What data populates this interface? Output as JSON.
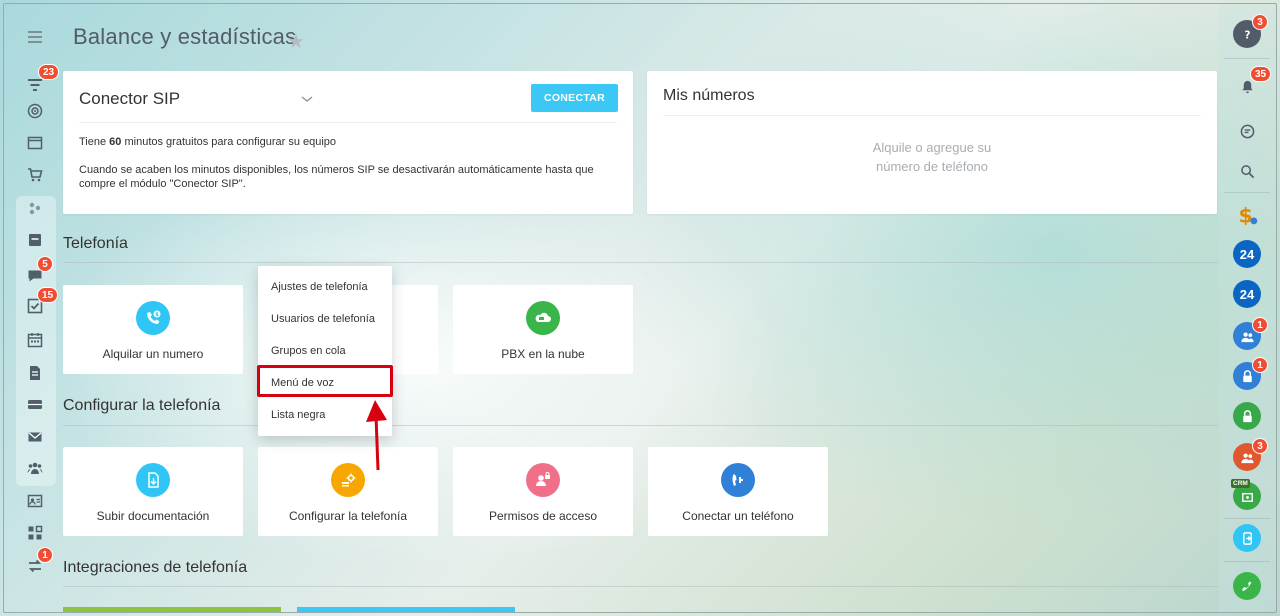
{
  "header": {
    "title": "Balance y estadísticas"
  },
  "sidebar": {
    "badges": {
      "filter": "23",
      "chat": "5",
      "tasks": "15",
      "sync": "1"
    }
  },
  "sip_card": {
    "title": "Conector SIP",
    "connect_label": "CONECTAR",
    "line1_pre": "Tiene ",
    "line1_bold": "60",
    "line1_post": " minutos gratuitos para configurar su equipo",
    "line2": "Cuando se acaben los minutos disponibles, los números SIP se desactivarán automáticamente hasta que compre el módulo \"Conector SIP\"."
  },
  "numbers_card": {
    "title": "Mis números",
    "empty_line1": "Alquile o agregue su",
    "empty_line2": "número de teléfono"
  },
  "sections": {
    "telefonia": "Telefonía",
    "configurar": "Configurar la telefonía",
    "integraciones": "Integraciones de telefonía"
  },
  "tiles": {
    "alquilar": "Alquilar un numero",
    "pbx": "PBX en la nube",
    "subir": "Subir documentación",
    "configurar": "Configurar la telefonía",
    "permisos": "Permisos de acceso",
    "conectar": "Conectar un teléfono"
  },
  "menu": {
    "items": [
      "Ajustes de telefonía",
      "Usuarios de telefonía",
      "Grupos en cola",
      "Menú de voz",
      "Lista negra"
    ]
  },
  "right_sidebar": {
    "badges": {
      "help": "3",
      "notifications": "35",
      "group1": "1",
      "lock1": "1",
      "group2": "3"
    },
    "b24_label": "24",
    "crm_label": "CRM"
  },
  "colors": {
    "accent": "#3bc8f5",
    "badge": "#f04d33",
    "highlight": "#d7000f"
  }
}
